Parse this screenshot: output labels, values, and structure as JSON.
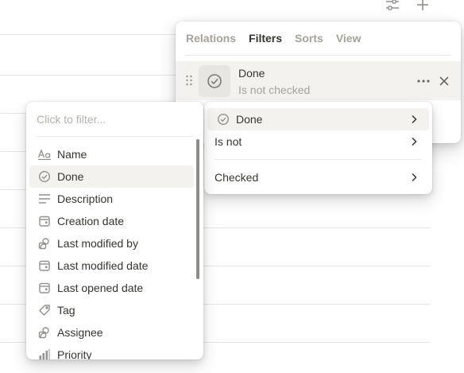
{
  "toolbar": {
    "icons": [
      "filter-settings-icon",
      "plus-icon"
    ]
  },
  "filter_panel": {
    "tabs": [
      {
        "label": "Relations",
        "active": false
      },
      {
        "label": "Filters",
        "active": true
      },
      {
        "label": "Sorts",
        "active": false
      },
      {
        "label": "View",
        "active": false
      }
    ],
    "filter": {
      "property": "Done",
      "condition": "Is not checked",
      "icon": "checkbox-circle-icon"
    }
  },
  "condition_menu": {
    "property_label": "Done",
    "operator_label": "Is not",
    "value_label": "Checked"
  },
  "property_picker": {
    "search_placeholder": "Click to filter...",
    "items": [
      {
        "label": "Name",
        "icon": "text-icon"
      },
      {
        "label": "Done",
        "icon": "checkbox-circle-icon",
        "highlighted": true
      },
      {
        "label": "Description",
        "icon": "lines-icon"
      },
      {
        "label": "Creation date",
        "icon": "calendar-icon"
      },
      {
        "label": "Last modified by",
        "icon": "person-icon"
      },
      {
        "label": "Last modified date",
        "icon": "calendar-icon"
      },
      {
        "label": "Last opened date",
        "icon": "calendar-icon"
      },
      {
        "label": "Tag",
        "icon": "tag-icon"
      },
      {
        "label": "Assignee",
        "icon": "person-icon"
      },
      {
        "label": "Priority",
        "icon": "bar-chart-icon"
      }
    ]
  },
  "colors": {
    "text": "#37352f",
    "muted": "#a6a299",
    "hover": "#f3f2ef",
    "icon": "#91918e"
  }
}
